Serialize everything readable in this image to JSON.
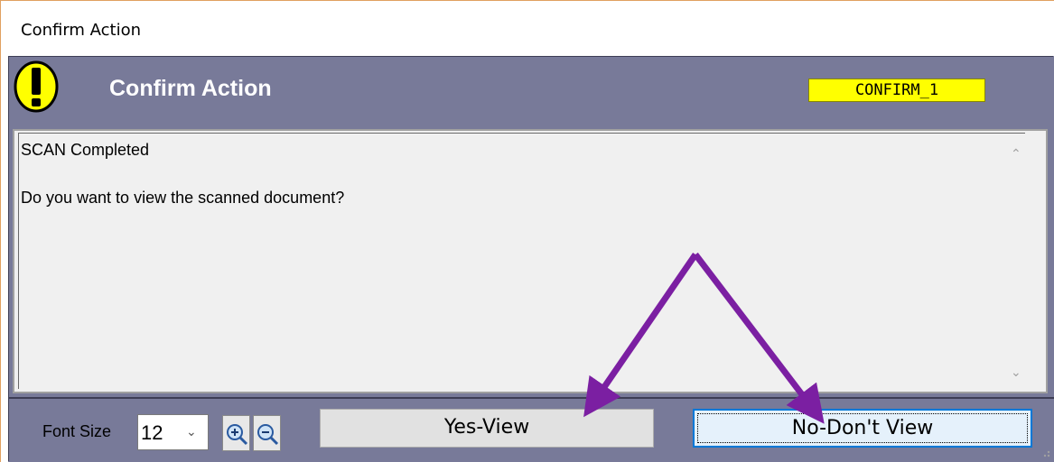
{
  "window": {
    "title": "Confirm Action"
  },
  "header": {
    "title": "Confirm Action",
    "code": "CONFIRM_1",
    "icon": "warning-icon",
    "badge_color": "#ffff00",
    "band_color": "#787a99"
  },
  "message": {
    "line1": "SCAN Completed",
    "line2": "Do you want to view the scanned document?"
  },
  "footer": {
    "font_size_label": "Font Size",
    "font_size_value": "12",
    "zoom_in_icon": "zoom-in-icon",
    "zoom_out_icon": "zoom-out-icon",
    "yes_label": "Yes-View",
    "no_label": "No-Don't View"
  },
  "annotation": {
    "arrow_color": "#7b1fa2"
  }
}
